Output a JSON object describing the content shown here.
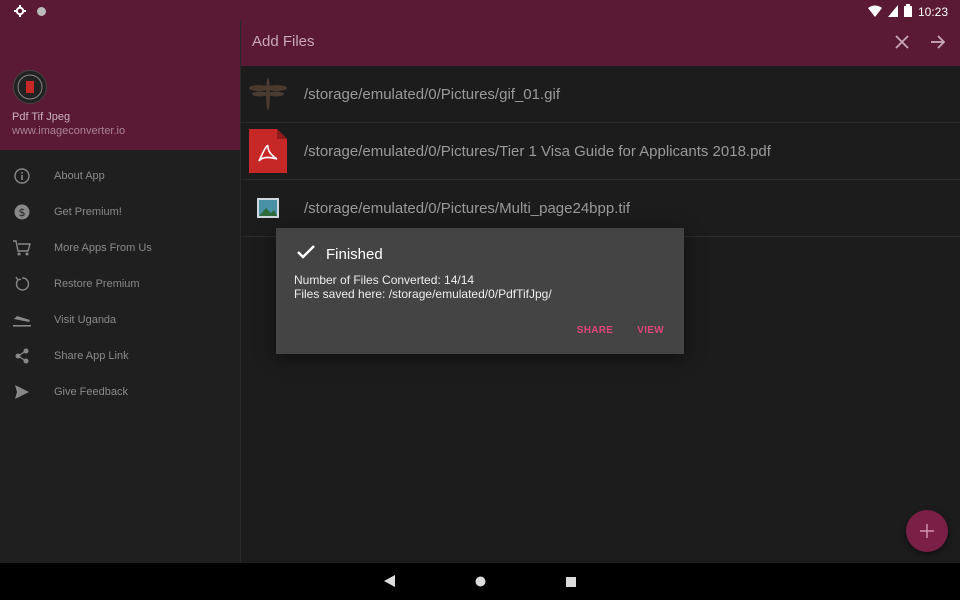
{
  "status": {
    "time": "10:23"
  },
  "appbar": {
    "title": "Add Files"
  },
  "files": [
    {
      "path": "/storage/emulated/0/Pictures/gif_01.gif",
      "icon": "dragonfly-gif-thumb-icon"
    },
    {
      "path": "/storage/emulated/0/Pictures/Tier 1 Visa Guide for Applicants 2018.pdf",
      "icon": "pdf-file-icon"
    },
    {
      "path": "/storage/emulated/0/Pictures/Multi_page24bpp.tif",
      "icon": "image-file-icon"
    }
  ],
  "drawer": {
    "app_name": "Pdf Tif Jpeg",
    "app_url": "www.imageconverter.io",
    "items": [
      {
        "label": "About App",
        "icon": "info-icon"
      },
      {
        "label": "Get Premium!",
        "icon": "dollar-icon"
      },
      {
        "label": "More Apps From Us",
        "icon": "cart-icon"
      },
      {
        "label": "Restore Premium",
        "icon": "restore-icon"
      },
      {
        "label": "Visit Uganda",
        "icon": "plane-icon"
      },
      {
        "label": "Share App Link",
        "icon": "share-icon"
      },
      {
        "label": "Give Feedback",
        "icon": "send-icon"
      }
    ]
  },
  "dialog": {
    "title": "Finished",
    "line1": "Number of Files Converted: 14/14",
    "line2": "Files saved here: /storage/emulated/0/PdfTifJpg/",
    "share_label": "SHARE",
    "view_label": "VIEW"
  },
  "colors": {
    "primary": "#5a1a33",
    "accent": "#e0457a",
    "fab": "#7a1f45"
  }
}
